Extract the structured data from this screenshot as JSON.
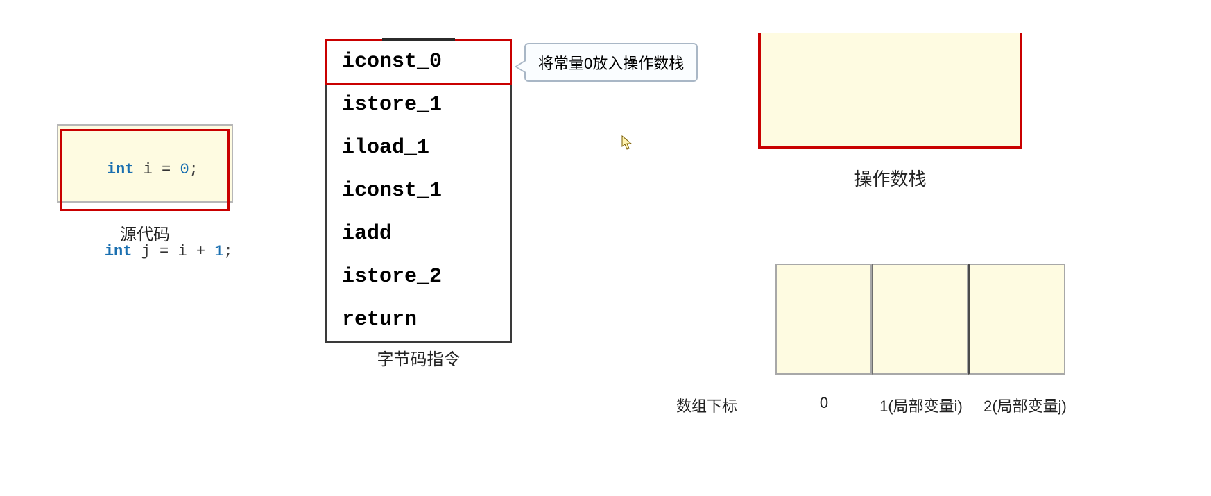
{
  "source": {
    "label": "源代码",
    "line1": {
      "kw": "int",
      "sp1": " ",
      "var": "i",
      "sp2": " ",
      "op": "=",
      "sp3": " ",
      "num": "0",
      "semi": ";"
    },
    "line2": {
      "kw": "int",
      "sp1": " ",
      "var": "j",
      "sp2": " ",
      "op1": "=",
      "sp3": " ",
      "rhs1": "i",
      "sp4": " ",
      "op2": "+",
      "sp5": " ",
      "num": "1",
      "semi": ";"
    }
  },
  "bytecode": {
    "label": "字节码指令",
    "lines": [
      "iconst_0",
      "istore_1",
      "iload_1",
      "iconst_1",
      "iadd",
      "istore_2",
      "return"
    ],
    "current_index": 0
  },
  "callout": {
    "text": "将常量0放入操作数栈"
  },
  "stack": {
    "label": "操作数栈"
  },
  "lvar": {
    "index_label": "数组下标",
    "idx0": "0",
    "idx1": "1(局部变量i)",
    "idx2": "2(局部变量j)"
  }
}
